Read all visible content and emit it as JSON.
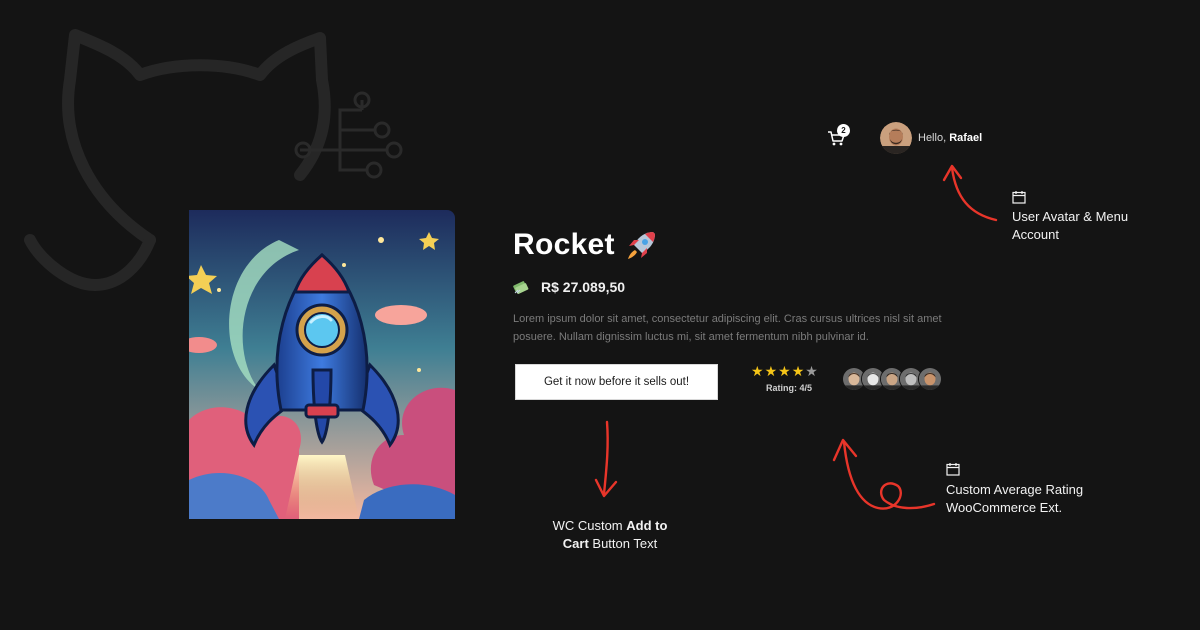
{
  "header": {
    "cart_count": "2",
    "greeting_prefix": "Hello, ",
    "user_name": "Rafael"
  },
  "product": {
    "title": "Rocket",
    "price": "R$ 27.089,50",
    "description": "Lorem ipsum dolor sit amet, consectetur adipiscing elit. Cras cursus ultrices nisl sit amet posuere. Nullam dignissim luctus mi, sit amet fermentum nibh pulvinar id.",
    "cta_label": "Get it now before it sells out!",
    "rating_value": 4,
    "rating_max": 5,
    "rating_label": "Rating: 4/5",
    "reviewer_count": 5
  },
  "annotations": {
    "avatar_menu": "User Avatar & Menu Account",
    "rating": "Custom Average Rating WooCommerce Ext.",
    "cart_prefix": "WC Custom ",
    "cart_bold1": "Add to",
    "cart_bold2": "Cart",
    "cart_suffix": " Button Text"
  },
  "icons": {
    "cart": "cart-icon",
    "money": "money-icon",
    "rocket": "rocket-emoji-icon",
    "annotation": "calendar-icon",
    "star": "star-icon"
  },
  "colors": {
    "background": "#141414",
    "arrow": "#e8352a",
    "star": "#f5c518",
    "button_bg": "#ffffff"
  }
}
